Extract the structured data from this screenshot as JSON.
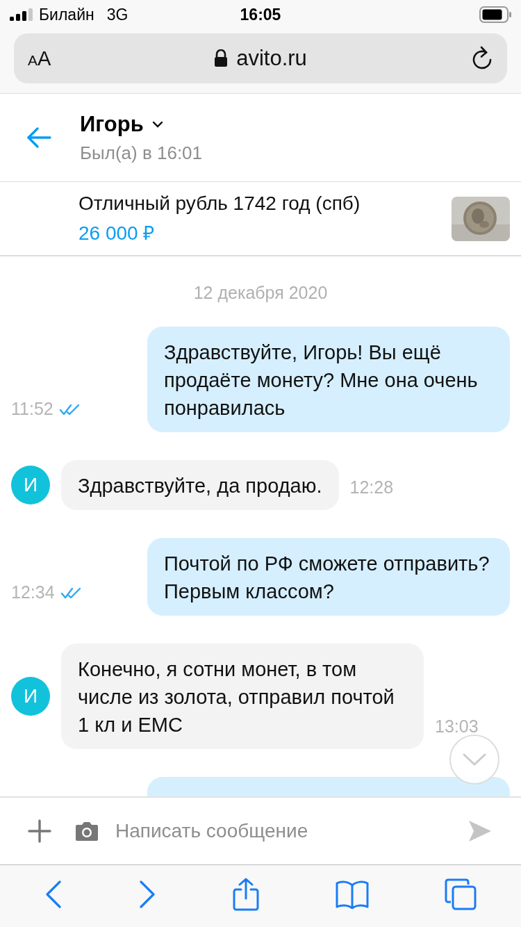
{
  "status_bar": {
    "carrier": "Билайн",
    "network": "3G",
    "time": "16:05"
  },
  "url_bar": {
    "text_size_button": "AA",
    "address": "avito.ru"
  },
  "chat_header": {
    "name": "Игорь",
    "last_seen": "Был(а) в 16:01"
  },
  "listing": {
    "title": "Отличный рубль 1742 год (спб)",
    "price": "26 000 ₽"
  },
  "date_divider": "12 декабря 2020",
  "messages": [
    {
      "kind": "outgoing",
      "text": "Здравствуйте, Игорь! Вы ещё продаёте монету? Мне она очень понравилась",
      "time": "11:52",
      "read": true
    },
    {
      "kind": "incoming",
      "avatar": "И",
      "text": "Здравствуйте, да продаю.",
      "time": "12:28"
    },
    {
      "kind": "outgoing",
      "text": "Почтой по РФ сможете отправить? Первым классом?",
      "time": "12:34",
      "read": true
    },
    {
      "kind": "incoming",
      "avatar": "И",
      "text": "Конечно, я сотни монет, в том числе из золота, отправил почтой 1 кл и ЕМС",
      "time": "13:03"
    },
    {
      "kind": "outgoing_cut"
    }
  ],
  "composer": {
    "placeholder": "Написать сообщение"
  }
}
